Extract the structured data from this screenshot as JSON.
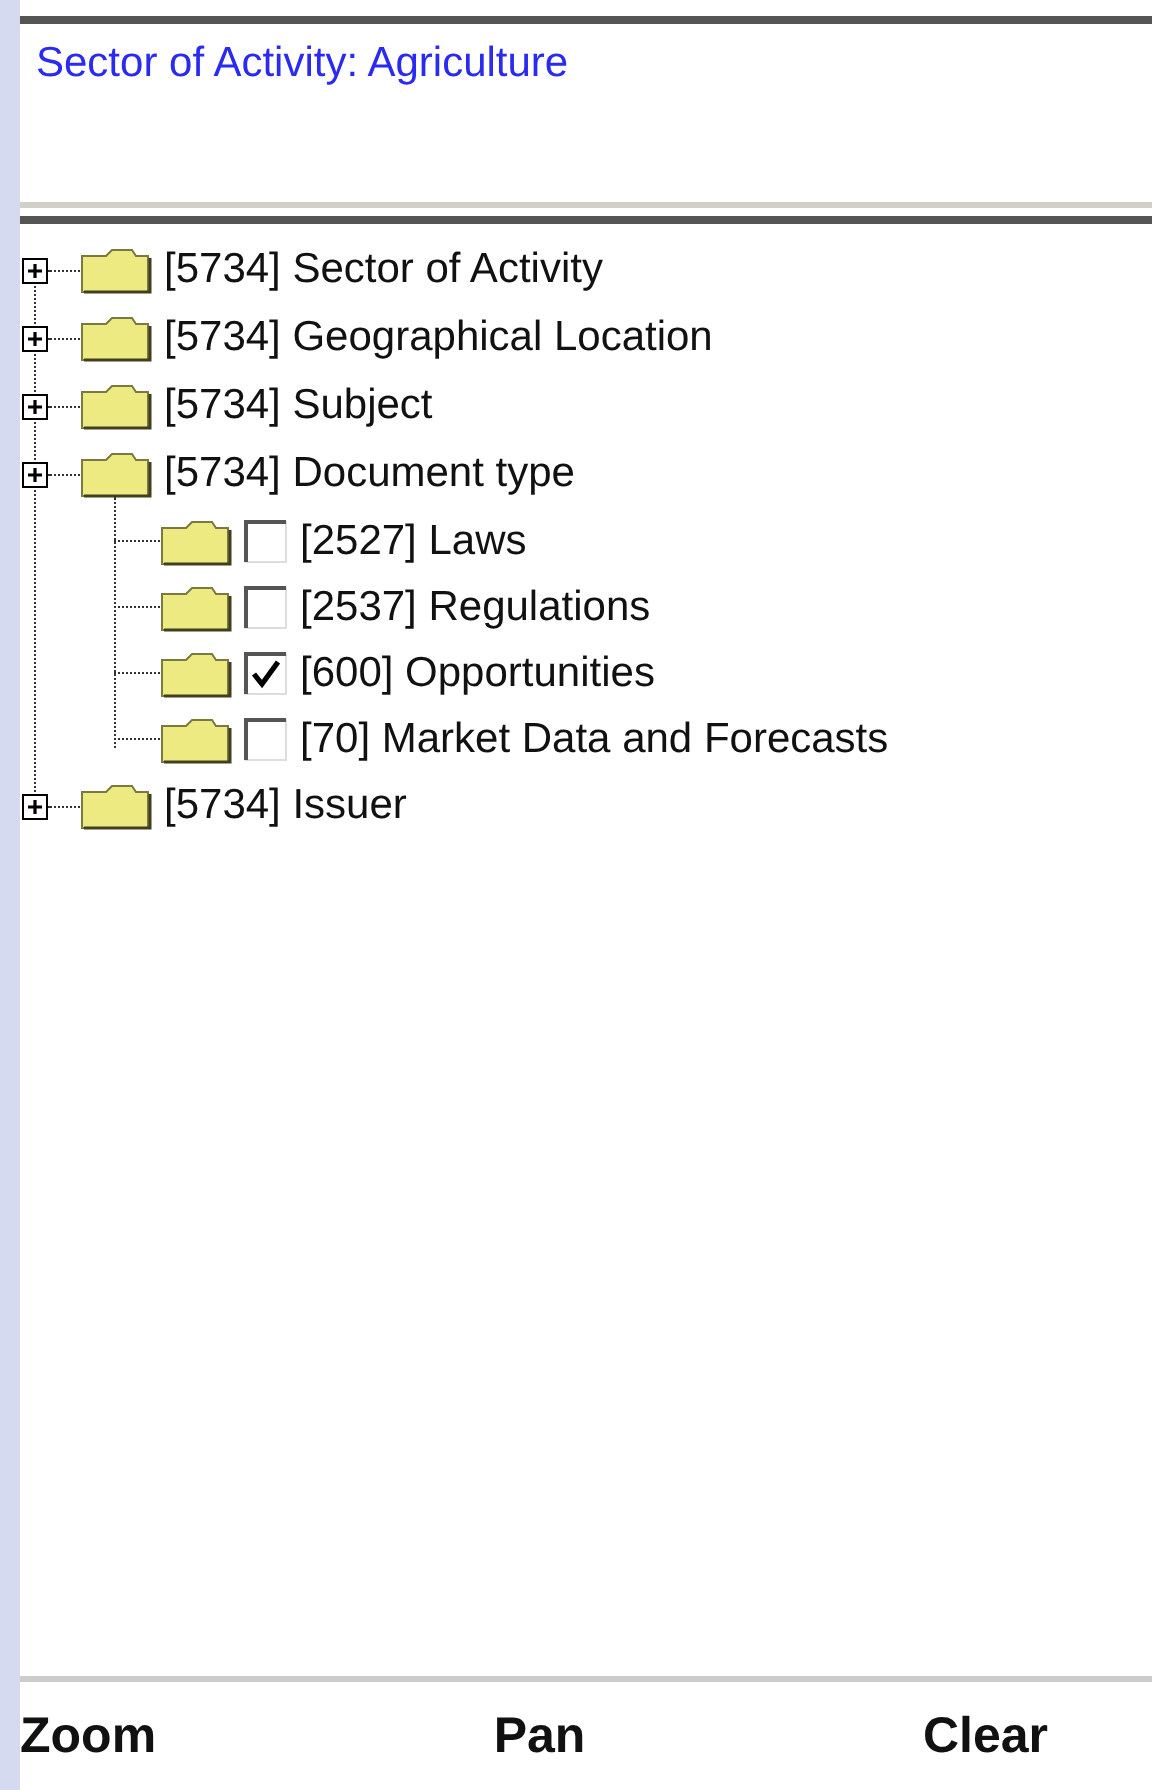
{
  "filter_summary": "Sector of Activity: Agriculture",
  "tree": [
    {
      "count": "[5734]",
      "label": "Sector of Activity"
    },
    {
      "count": "[5734]",
      "label": "Geographical Location"
    },
    {
      "count": "[5734]",
      "label": "Subject"
    },
    {
      "count": "[5734]",
      "label": "Document type",
      "children": [
        {
          "count": "[2527]",
          "label": "Laws",
          "checked": false
        },
        {
          "count": "[2537]",
          "label": "Regulations",
          "checked": false
        },
        {
          "count": "[600]",
          "label": "Opportunities",
          "checked": true
        },
        {
          "count": "[70]",
          "label": "Market Data and Forecasts",
          "checked": false
        }
      ]
    },
    {
      "count": "[5734]",
      "label": "Issuer"
    }
  ],
  "softkeys": [
    "Zoom",
    "Pan",
    "Clear"
  ]
}
